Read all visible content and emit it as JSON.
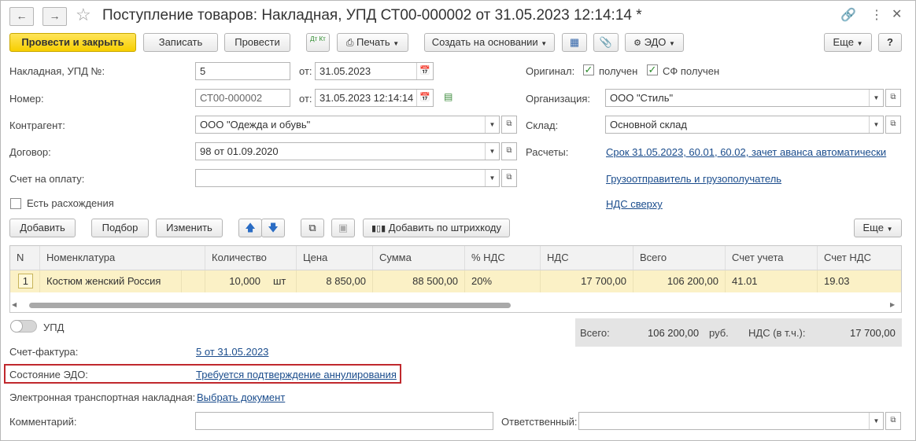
{
  "window": {
    "title": "Поступление товаров: Накладная, УПД СТ00-000002 от 31.05.2023 12:14:14 *"
  },
  "toolbar": {
    "post_close": "Провести и закрыть",
    "save": "Записать",
    "post": "Провести",
    "dt_kt": "Дт Кт",
    "print": "Печать",
    "create_based": "Создать на основании",
    "edo": "ЭДО",
    "more": "Еще",
    "help": "?"
  },
  "form": {
    "invoice_no_label": "Накладная, УПД №:",
    "invoice_no": "5",
    "from_label": "от:",
    "invoice_date": "31.05.2023",
    "number_label": "Номер:",
    "number": "СТ00-000002",
    "number_date": "31.05.2023 12:14:14",
    "counterparty_label": "Контрагент:",
    "counterparty": "ООО \"Одежда и обувь\"",
    "contract_label": "Договор:",
    "contract": "98 от 01.09.2020",
    "payment_account_label": "Счет на оплату:",
    "payment_account": "",
    "discrepancy_label": "Есть расхождения",
    "original_label": "Оригинал:",
    "received_label": "получен",
    "sf_received_label": "СФ получен",
    "organization_label": "Организация:",
    "organization": "ООО \"Стиль\"",
    "warehouse_label": "Склад:",
    "warehouse": "Основной склад",
    "settlements_label": "Расчеты:",
    "settlements_link": "Срок 31.05.2023, 60.01, 60.02, зачет аванса автоматически",
    "shipper_link": "Грузоотправитель и грузополучатель",
    "vat_link": "НДС сверху"
  },
  "table_toolbar": {
    "add": "Добавить",
    "pick": "Подбор",
    "change": "Изменить",
    "add_barcode": "Добавить по штрихкоду",
    "more": "Еще"
  },
  "table": {
    "columns": [
      "N",
      "Номенклатура",
      "Количество",
      "Цена",
      "Сумма",
      "% НДС",
      "НДС",
      "Всего",
      "Счет учета",
      "Счет НДС"
    ],
    "rows": [
      {
        "n": "1",
        "item": "Костюм женский Россия",
        "qty": "10,000",
        "unit": "шт",
        "price": "8 850,00",
        "sum": "88 500,00",
        "vat_rate": "20%",
        "vat": "17 700,00",
        "total": "106 200,00",
        "account": "41.01",
        "vat_account": "19.03"
      }
    ]
  },
  "bottom": {
    "upd_label": "УПД",
    "total_label": "Всего:",
    "total_value": "106 200,00",
    "currency": "руб.",
    "vat_incl_label": "НДС (в т.ч.):",
    "vat_incl_value": "17 700,00",
    "invoice_label": "Счет-фактура:",
    "invoice_link": "5 от 31.05.2023",
    "edo_state_label": "Состояние ЭДО:",
    "edo_state_link": "Требуется подтверждение аннулирования",
    "etn_label": "Электронная транспортная накладная:",
    "etn_link": "Выбрать документ",
    "comment_label": "Комментарий:",
    "comment": "",
    "responsible_label": "Ответственный:",
    "responsible": ""
  },
  "colors": {
    "primary_button": "#f7cf00",
    "selected_row": "#fbf1c6",
    "link": "#1a4c8c",
    "highlight_border": "#c0282d",
    "checkmark": "#2a8a2a"
  }
}
